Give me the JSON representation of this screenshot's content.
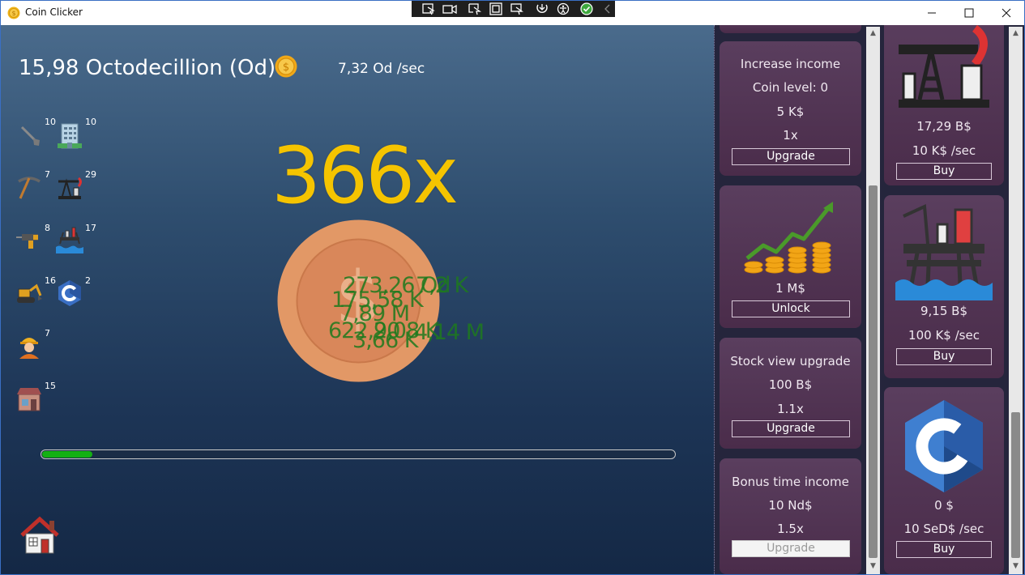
{
  "window": {
    "title": "Coin Clicker",
    "controls": {
      "minimize": "minimize-icon",
      "maximize": "maximize-icon",
      "close": "close-icon"
    }
  },
  "debug_toolbar": {
    "icons": [
      "select-element-icon",
      "live-preview-icon",
      "track-focus-icon",
      "display-layout-adorners-icon",
      "toggle-hot-reload-icon",
      "accessibility-icon",
      "checkmark-icon",
      "collapse-icon"
    ]
  },
  "game": {
    "balance": "15,98 Octodecillion (Od)",
    "income_rate": "7,32 Od /sec",
    "multiplier": "366x",
    "progress_fraction": 0.08,
    "floating_numbers": [
      "273,26 Od",
      "7,2 K",
      "175,58 K",
      "7,89 M",
      "622,20",
      "9,08 K",
      "4,14 M",
      "3,66 K"
    ],
    "buildings": [
      {
        "icon": "shovel-icon",
        "count": "10"
      },
      {
        "icon": "office-building-icon",
        "count": "10"
      },
      {
        "icon": "pickaxe-icon",
        "count": "7"
      },
      {
        "icon": "oil-pump-icon",
        "count": "29"
      },
      {
        "icon": "drill-icon",
        "count": "8"
      },
      {
        "icon": "oil-platform-icon",
        "count": "17"
      },
      {
        "icon": "excavator-icon",
        "count": "16"
      },
      {
        "icon": "c-language-icon",
        "count": "2"
      },
      {
        "icon": "miner-worker-icon",
        "count": "7"
      },
      {
        "icon": "shop-store-icon",
        "count": "15"
      }
    ]
  },
  "upgrades": [
    {
      "title": "Increase income",
      "level": "Coin level: 0",
      "price": "5 K$",
      "value": "1x",
      "button": "Upgrade",
      "enabled": true
    },
    {
      "icon": "growth-chart-coins-icon",
      "price": "1 M$",
      "button": "Unlock",
      "enabled": true
    },
    {
      "title": "Stock view upgrade",
      "price": "100 B$",
      "value": "1.1x",
      "button": "Upgrade",
      "enabled": true
    },
    {
      "title": "Bonus time income",
      "price": "10 Nd$",
      "value": "1.5x",
      "button": "Upgrade",
      "enabled": false
    }
  ],
  "shop": [
    {
      "icon": "oil-pump-icon",
      "price": "17,29 B$",
      "rate": "10 K$ /sec",
      "button": "Buy"
    },
    {
      "icon": "oil-platform-icon",
      "price": "9,15 B$",
      "rate": "100 K$ /sec",
      "button": "Buy"
    },
    {
      "icon": "c-language-icon",
      "price": "0 $",
      "rate": "10 SeD$ /sec",
      "button": "Buy"
    }
  ],
  "colors": {
    "accent_gold": "#f5c400",
    "progress_green": "#13b013",
    "card_bg": "#4a2c4a",
    "panel_bg": "#25253c",
    "float_green": "#1e7a1e"
  }
}
